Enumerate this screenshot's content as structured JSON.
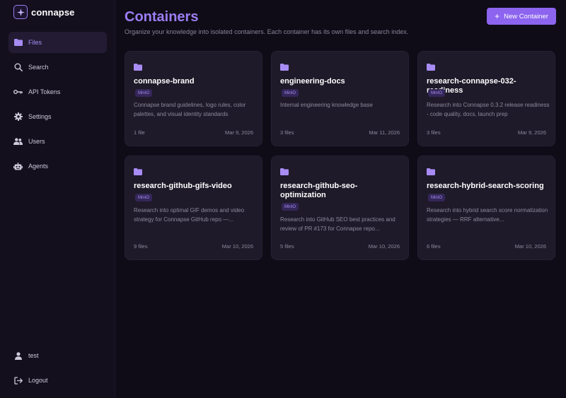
{
  "brand": {
    "name": "connapse",
    "accent": "#9c7df3"
  },
  "sidebar": {
    "items": [
      {
        "label": "Files",
        "icon": "folder-icon",
        "active": true
      },
      {
        "label": "Search",
        "icon": "search-icon"
      },
      {
        "label": "API Tokens",
        "icon": "key-icon"
      },
      {
        "label": "Settings",
        "icon": "gear-icon"
      },
      {
        "label": "Users",
        "icon": "users-icon"
      },
      {
        "label": "Agents",
        "icon": "robot-icon"
      }
    ],
    "bottom": [
      {
        "label": "test",
        "icon": "user-icon"
      },
      {
        "label": "Logout",
        "icon": "logout-icon"
      }
    ]
  },
  "header": {
    "title": "Containers",
    "subtitle": "Organize your knowledge into isolated containers. Each container has its own files and search index.",
    "new_button_label": "New Container"
  },
  "containers": [
    {
      "name": "connapse-brand",
      "badge": "MinIO",
      "description": "Connapse brand guidelines, logo rules, color palettes, and visual identity standards",
      "files": "1 file",
      "date": "Mar 9, 2026"
    },
    {
      "name": "engineering-docs",
      "badge": "MinIO",
      "description": "Internal engineering knowledge base",
      "files": "3 files",
      "date": "Mar 11, 2026"
    },
    {
      "name": "research-connapse-032-readiness",
      "badge": "MinIO",
      "description": "Research into Connapse 0.3.2 release readiness - code quality, docs, launch prep",
      "files": "3 files",
      "date": "Mar 9, 2026"
    },
    {
      "name": "research-github-gifs-video",
      "badge": "MinIO",
      "description": "Research into optimal GIF demos and video strategy for Connapse GitHub repo —...",
      "files": "9 files",
      "date": "Mar 10, 2026"
    },
    {
      "name": "research-github-seo-optimization",
      "badge": "MinIO",
      "description": "Research into GitHub SEO best practices and review of PR #173 for Connapse repo...",
      "files": "5 files",
      "date": "Mar 10, 2026"
    },
    {
      "name": "research-hybrid-search-scoring",
      "badge": "MinIO",
      "description": "Research into hybrid search score normalization strategies — RRF alternative...",
      "files": "6 files",
      "date": "Mar 10, 2026"
    }
  ]
}
